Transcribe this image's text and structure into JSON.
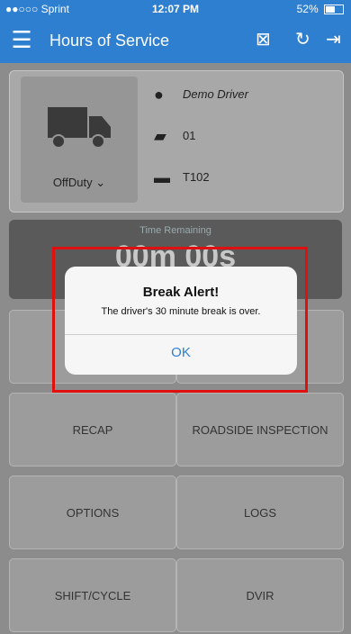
{
  "status": {
    "carrier": "●●○○○ Sprint",
    "time": "12:07 PM",
    "battery": "52%"
  },
  "nav": {
    "title": "Hours of Service"
  },
  "driver": {
    "name": "Demo Driver",
    "unit": "01",
    "trailer": "T102",
    "duty_status": "OffDuty"
  },
  "timer": {
    "label": "Time Remaining",
    "value": "00m 00s"
  },
  "tiles": {
    "recap": "RECAP",
    "roadside": "ROADSIDE INSPECTION",
    "options": "OPTIONS",
    "logs": "LOGS",
    "shift": "SHIFT/CYCLE",
    "dvir": "DVIR"
  },
  "alert": {
    "title": "Break Alert!",
    "message": "The driver's 30 minute break is over.",
    "ok": "OK"
  },
  "colors": {
    "accent": "#2f7fd0",
    "highlight": "#e01010"
  }
}
